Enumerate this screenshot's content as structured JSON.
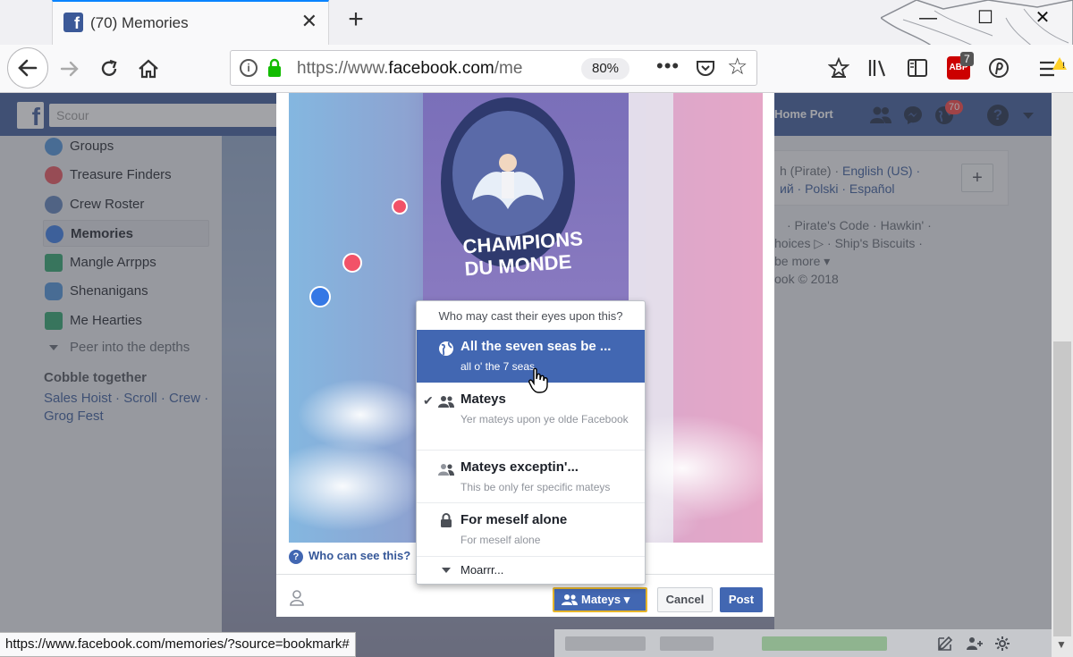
{
  "browser": {
    "tab_title": "(70) Memories",
    "tab_close": "✕",
    "new_tab": "+",
    "url_prefix": "https://www.",
    "url_domain": "facebook.com",
    "url_rest": "/me",
    "zoom": "80%",
    "more_dots": "•••",
    "adblock_count": "7",
    "win_minimize": "—",
    "win_maximize": "☐",
    "win_close": "✕"
  },
  "facebook": {
    "search_placeholder": "Scour",
    "home_port": "Home Port",
    "notification_count": "70",
    "left_nav": [
      {
        "label": "Groups"
      },
      {
        "label": "Treasure Finders"
      },
      {
        "label": "Crew Roster"
      },
      {
        "label": "Memories"
      },
      {
        "label": "Mangle Arrpps"
      },
      {
        "label": "Shenanigans"
      },
      {
        "label": "Me Hearties"
      }
    ],
    "peer": "Peer into the depths",
    "cobble_heading": "Cobble together",
    "cobble_links_line1": "Sales Hoist · Scroll · Crew ·",
    "cobble_links_line2": "Grog Fest",
    "lang_line1_prefix": "h (Pirate) · ",
    "lang_line1_link": "English (US) ·",
    "lang_line2": "ий · Polski · Español",
    "lang_plus": "+",
    "footer_line1": "· Pirate's Code · Hawkin' ·",
    "footer_line2": "hoices ▷ · Ship's Biscuits ·",
    "footer_line3": "be more ▾",
    "footer_line4": "ook © 2018"
  },
  "modal": {
    "photo_text_line1": "CHAMPIONS",
    "photo_text_line2": "DU MONDE",
    "who_can_see": "Who can see this?",
    "audience_button": "Mateys ▾",
    "cancel": "Cancel",
    "post": "Post"
  },
  "privacy_dropdown": {
    "header": "Who may cast their eyes upon this?",
    "options": [
      {
        "title": "All the seven seas be ...",
        "subtitle": "all o' the 7 seas"
      },
      {
        "title": "Mateys",
        "subtitle": "Yer mateys upon ye olde Facebook"
      },
      {
        "title": "Mateys exceptin'...",
        "subtitle": "This be only fer specific mateys"
      },
      {
        "title": "For meself alone",
        "subtitle": "For meself alone"
      }
    ],
    "selected_check": "✔",
    "more": "Moarrr..."
  },
  "status_bar": {
    "url": "https://www.facebook.com/memories/?source=bookmark#"
  }
}
